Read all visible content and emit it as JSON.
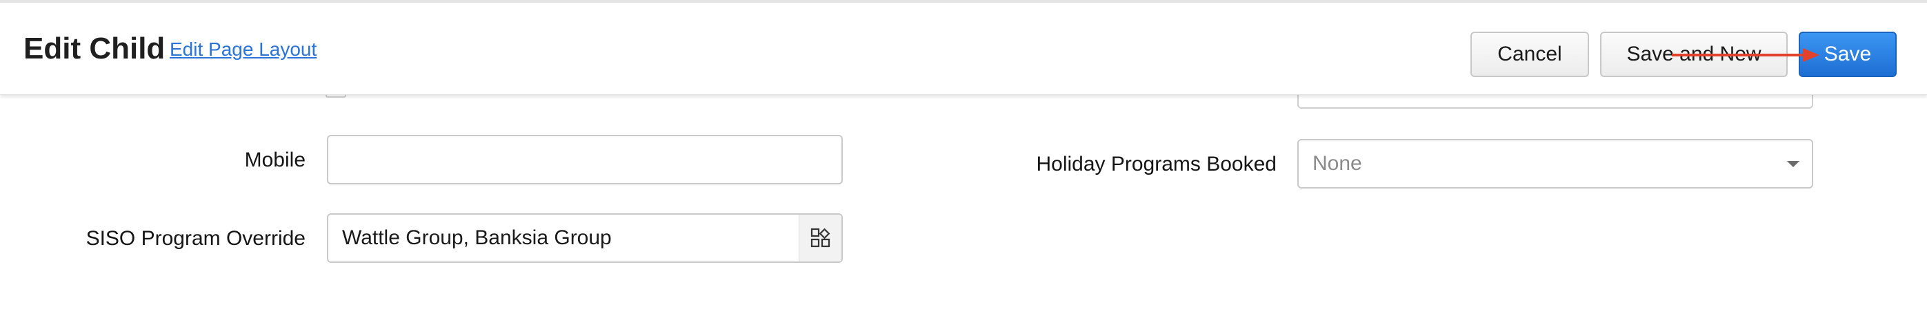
{
  "header": {
    "title": "Edit Child",
    "edit_layout_link": "Edit Page Layout",
    "buttons": {
      "cancel": "Cancel",
      "save_and_new": "Save and New",
      "save": "Save"
    }
  },
  "form": {
    "mobile": {
      "label": "Mobile",
      "value": ""
    },
    "siso_program_override": {
      "label": "SISO Program Override",
      "value": "Wattle Group, Banksia Group"
    },
    "holiday_programs_booked": {
      "label": "Holiday Programs Booked",
      "value": "None"
    }
  },
  "annotation": {
    "arrow_color": "#e2412c"
  },
  "colors": {
    "primary_button": "#2a80e6",
    "link": "#2a74d8"
  },
  "icons": {
    "picker": "lookup-grid-icon",
    "dropdown": "caret-down-icon"
  }
}
